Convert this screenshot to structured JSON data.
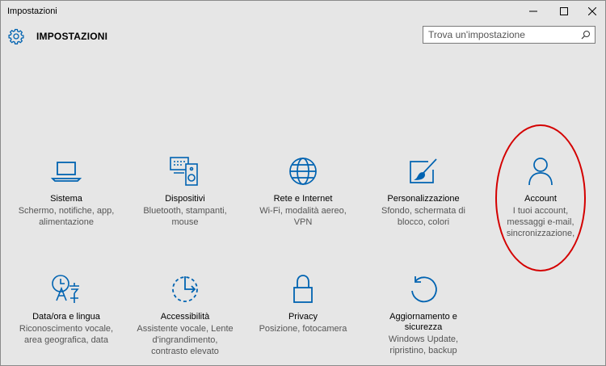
{
  "window": {
    "title": "Impostazioni",
    "controls": [
      "minimize-icon",
      "maximize-icon",
      "close-icon"
    ]
  },
  "header": {
    "heading": "IMPOSTAZIONI",
    "search_placeholder": "Trova un'impostazione"
  },
  "colors": {
    "accent": "#0063b1",
    "background": "#e6e6e6",
    "annotation": "#d40000"
  },
  "tiles": [
    {
      "icon": "laptop-icon",
      "title": "Sistema",
      "desc": "Schermo, notifiche, app,\nalimentazione"
    },
    {
      "icon": "devices-icon",
      "title": "Dispositivi",
      "desc": "Bluetooth, stampanti,\nmouse"
    },
    {
      "icon": "globe-icon",
      "title": "Rete e Internet",
      "desc": "Wi-Fi, modalità aereo,\nVPN"
    },
    {
      "icon": "personalization-icon",
      "title": "Personalizzazione",
      "desc": "Sfondo, schermata di\nblocco, colori"
    },
    {
      "icon": "person-icon",
      "title": "Account",
      "desc": "I tuoi account,\nmessaggi e-mail,\nsincronizzazione,"
    },
    {
      "icon": "language-icon",
      "title": "Data/ora e lingua",
      "desc": "Riconoscimento vocale,\narea geografica, data"
    },
    {
      "icon": "accessibility-icon",
      "title": "Accessibilità",
      "desc": "Assistente vocale, Lente\nd'ingrandimento,\ncontrasto elevato"
    },
    {
      "icon": "lock-icon",
      "title": "Privacy",
      "desc": "Posizione, fotocamera"
    },
    {
      "icon": "update-icon",
      "title": "Aggiornamento e\nsicurezza",
      "desc": "Windows Update,\nripristino, backup"
    }
  ]
}
